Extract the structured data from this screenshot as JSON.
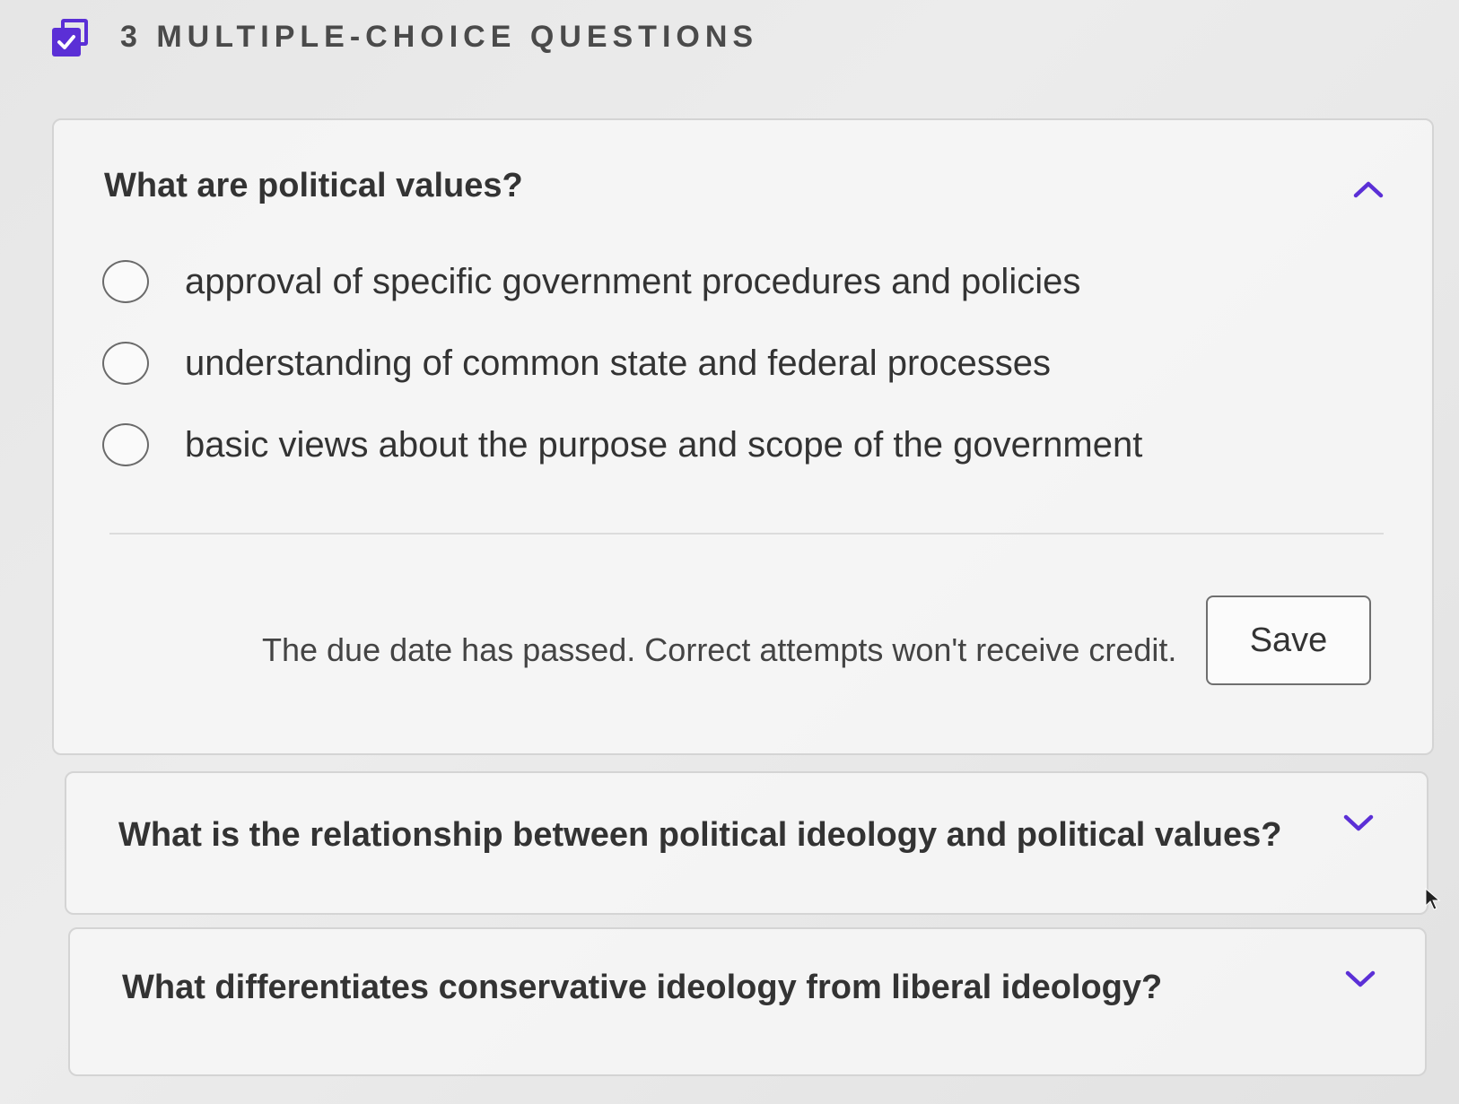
{
  "header": {
    "title": "3 MULTIPLE-CHOICE QUESTIONS",
    "icon": "checklist-icon",
    "accent_color": "#5b2fd6"
  },
  "questions": [
    {
      "title": "What are political values?",
      "expanded": true,
      "chevron": "chevron-up-icon",
      "options": [
        {
          "label": "approval of specific government procedures and policies",
          "selected": false
        },
        {
          "label": "understanding of common state and federal processes",
          "selected": false
        },
        {
          "label": "basic views about the purpose and scope of the government",
          "selected": false
        }
      ],
      "due_message": "The due date has passed. Correct attempts won't receive credit.",
      "save_label": "Save"
    },
    {
      "title": "What is the relationship between political ideology and political values?",
      "expanded": false,
      "chevron": "chevron-down-icon"
    },
    {
      "title": "What differentiates conservative ideology from liberal ideology?",
      "expanded": false,
      "chevron": "chevron-down-icon"
    }
  ]
}
